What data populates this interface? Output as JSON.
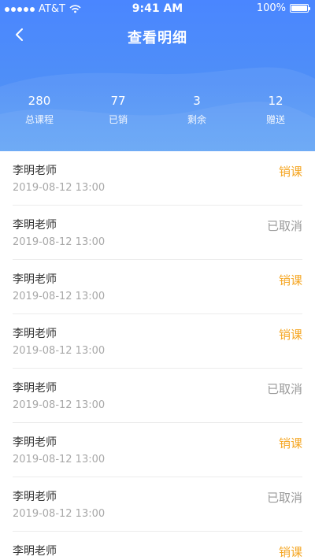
{
  "status_bar": {
    "carrier": "AT&T",
    "time": "9:41 AM",
    "battery": "100%"
  },
  "nav": {
    "title": "查看明细",
    "back_icon": "chevron-left-icon"
  },
  "stats": [
    {
      "value": "280",
      "label": "总课程"
    },
    {
      "value": "77",
      "label": "已销"
    },
    {
      "value": "3",
      "label": "剩余"
    },
    {
      "value": "12",
      "label": "赠送"
    }
  ],
  "records": [
    {
      "name": "李明老师",
      "time": "2019-08-12 13:00",
      "status": "销课",
      "kind": "sold"
    },
    {
      "name": "李明老师",
      "time": "2019-08-12 13:00",
      "status": "已取消",
      "kind": "cancel"
    },
    {
      "name": "李明老师",
      "time": "2019-08-12 13:00",
      "status": "销课",
      "kind": "sold"
    },
    {
      "name": "李明老师",
      "time": "2019-08-12 13:00",
      "status": "销课",
      "kind": "sold"
    },
    {
      "name": "李明老师",
      "time": "2019-08-12 13:00",
      "status": "已取消",
      "kind": "cancel"
    },
    {
      "name": "李明老师",
      "time": "2019-08-12 13:00",
      "status": "销课",
      "kind": "sold"
    },
    {
      "name": "李明老师",
      "time": "2019-08-12 13:00",
      "status": "已取消",
      "kind": "cancel"
    },
    {
      "name": "李明老师",
      "time": "",
      "status": "销课",
      "kind": "sold"
    }
  ],
  "colors": {
    "header_blue": "#4a86ff",
    "sold_orange": "#f5a623",
    "cancel_gray": "#999999"
  }
}
